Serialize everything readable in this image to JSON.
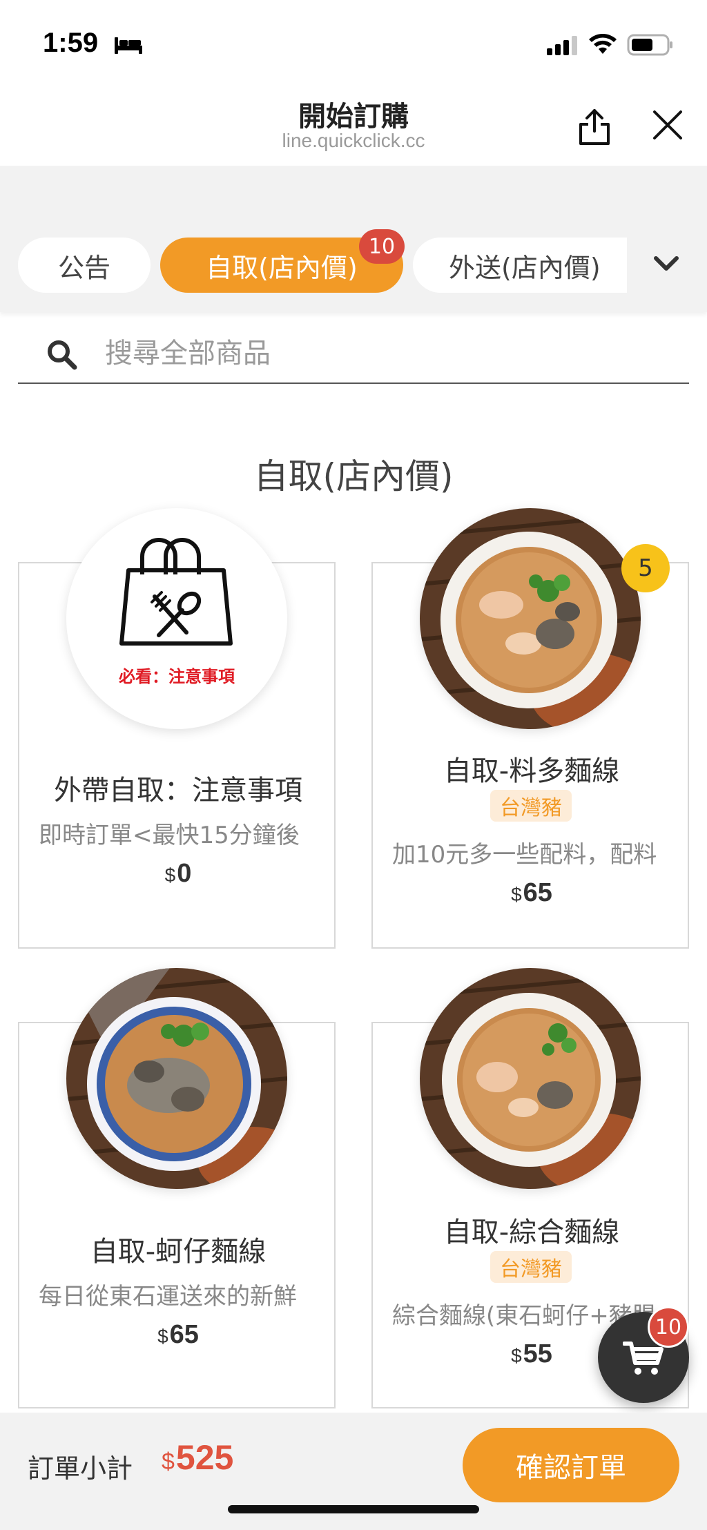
{
  "status_bar": {
    "time": "1:59"
  },
  "header": {
    "title": "開始訂購",
    "url": "line.quickclick.cc"
  },
  "tabs": [
    {
      "label": "公告",
      "active": false
    },
    {
      "label": "自取(店內價)",
      "active": true,
      "badge": "10"
    },
    {
      "label": "外送(店內價)",
      "active": false
    }
  ],
  "search": {
    "placeholder": "搜尋全部商品"
  },
  "section": {
    "title": "自取(店內價)"
  },
  "products": [
    {
      "name": "外帶自取：注意事項",
      "desc": "即時訂單<最快15分鐘後",
      "currency": "$",
      "price": "0",
      "image_caption": "必看：注意事項"
    },
    {
      "name": "自取-料多麵線",
      "tag": "台灣豬",
      "desc": "加10元多一些配料，配料",
      "currency": "$",
      "price": "65",
      "qty": "5"
    },
    {
      "name": "自取-蚵仔麵線",
      "desc": "每日從東石運送來的新鮮",
      "currency": "$",
      "price": "65"
    },
    {
      "name": "自取-綜合麵線",
      "tag": "台灣豬",
      "desc": "綜合麵線(東石蚵仔+豬腸",
      "currency": "$",
      "price": "55"
    }
  ],
  "cart": {
    "count": "10"
  },
  "footer": {
    "subtotal_label": "訂單小計",
    "currency": "$",
    "subtotal": "525",
    "confirm_label": "確認訂單"
  },
  "colors": {
    "accent": "#f29a26",
    "badge": "#d94a3d",
    "qty_badge": "#f7c21a",
    "price_red": "#e0543f"
  }
}
